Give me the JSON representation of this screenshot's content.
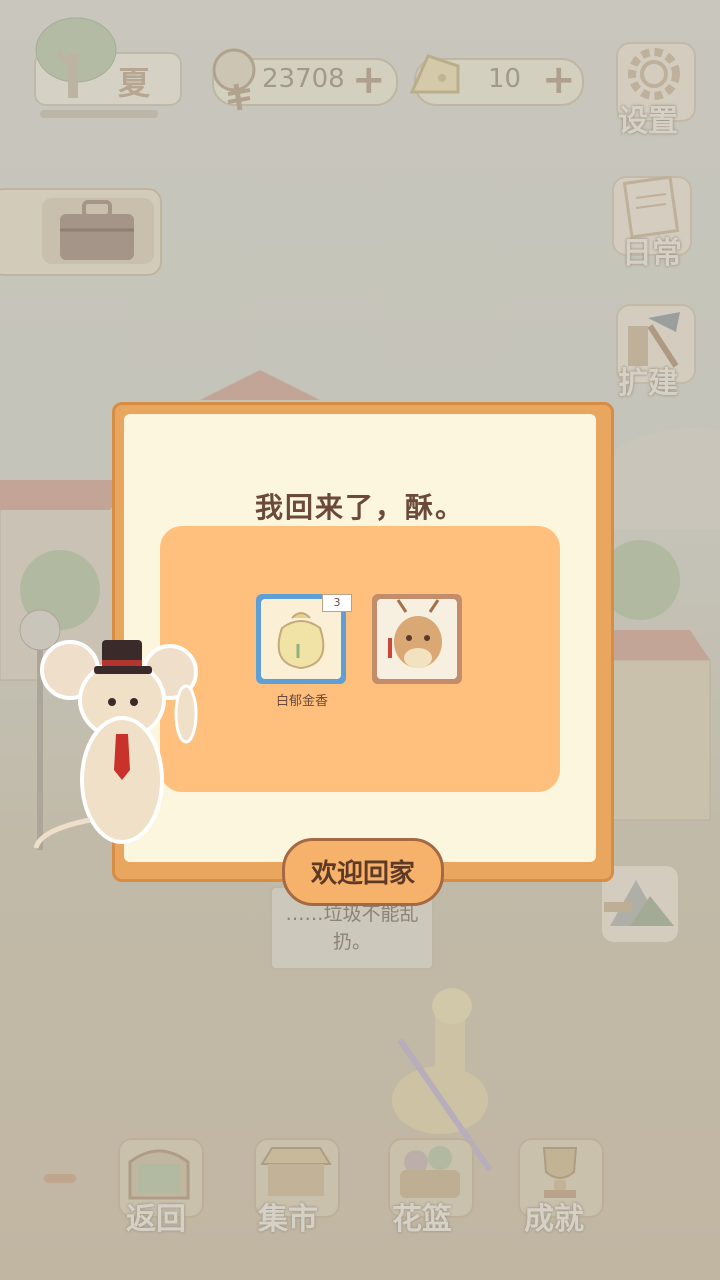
{
  "hud": {
    "season": "夏",
    "fish": "23708",
    "cheese": "10",
    "plus": "+"
  },
  "side": {
    "settings": "设置",
    "daily": "日常",
    "expand": "扩建"
  },
  "scene": {
    "speech": "……垃圾不能乱扔。"
  },
  "dialog": {
    "message": "我回来了，酥。",
    "reward_item": {
      "name": "白郁金香",
      "count": "3"
    },
    "confirm": "欢迎回家"
  },
  "bottom": {
    "back": "返回",
    "market": "集市",
    "basket": "花篮",
    "achievement": "成就"
  },
  "colors": {
    "dialog_frame": "#e9a65e",
    "dialog_body": "#fdf6df",
    "reward_panel": "#ffc07e",
    "confirm_button": "#f6b26b",
    "item_rarity_blue": "#5f9fd8"
  },
  "icons": [
    "tree-icon",
    "fish-bone-icon",
    "cheese-icon",
    "gear-icon",
    "memo-icon",
    "build-tools-icon",
    "briefcase-icon",
    "mountain-signpost-icon",
    "window-icon",
    "market-stall-icon",
    "flower-basket-icon",
    "trophy-icon",
    "seed-bag-icon",
    "deer-portrait-icon"
  ]
}
